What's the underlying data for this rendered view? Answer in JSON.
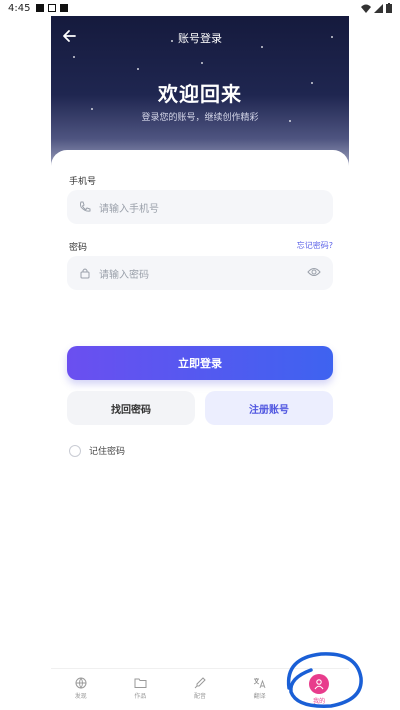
{
  "status_bar": {
    "time": "4:45"
  },
  "header": {
    "title": "账号登录"
  },
  "hero": {
    "title": "欢迎回来",
    "subtitle": "登录您的账号，继续创作精彩"
  },
  "form": {
    "phone_label": "手机号",
    "phone_placeholder": "请输入手机号",
    "password_label": "密码",
    "forgot_link": "忘记密码?",
    "password_placeholder": "请输入密码",
    "remember_label": "记住密码"
  },
  "actions": {
    "login": "立即登录",
    "find_password": "找回密码",
    "register": "注册账号"
  },
  "tabbar": {
    "items": [
      {
        "label": "发现",
        "icon": "globe-icon"
      },
      {
        "label": "作品",
        "icon": "folder-icon"
      },
      {
        "label": "配音",
        "icon": "microphone-icon"
      },
      {
        "label": "翻译",
        "icon": "translate-icon"
      },
      {
        "label": "我的",
        "icon": "user-icon",
        "active": true
      }
    ]
  },
  "colors": {
    "accent": "#5b61e8",
    "active_tab": "#e83c8c",
    "annotation": "#1a5fd6"
  }
}
